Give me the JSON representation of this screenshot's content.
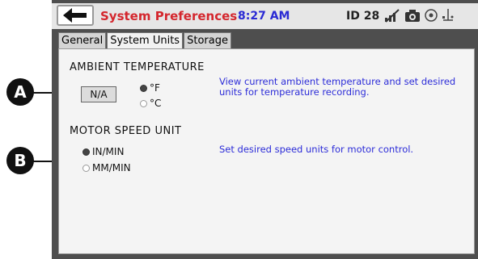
{
  "header": {
    "title": "System Preferences",
    "time": "8:27 AM",
    "id_label": "ID 28"
  },
  "tabs": [
    {
      "label": "General"
    },
    {
      "label": "System Units"
    },
    {
      "label": "Storage"
    }
  ],
  "temperature": {
    "title": "AMBIENT TEMPERATURE",
    "current_value": "N/A",
    "options": [
      {
        "label": "°F",
        "selected": true
      },
      {
        "label": "°C",
        "selected": false
      }
    ],
    "description": "View current ambient temperature and set desired units for temperature recording."
  },
  "motor_speed": {
    "title": "MOTOR SPEED UNIT",
    "options": [
      {
        "label": "IN/MIN",
        "selected": true
      },
      {
        "label": "MM/MIN",
        "selected": false
      }
    ],
    "description": "Set desired speed units for motor control."
  },
  "callouts": {
    "a": "A",
    "b": "B"
  },
  "colors": {
    "title": "#d4262d",
    "time": "#2a2ad4",
    "description": "#2c2cd8",
    "frame": "#4e4e4e"
  }
}
